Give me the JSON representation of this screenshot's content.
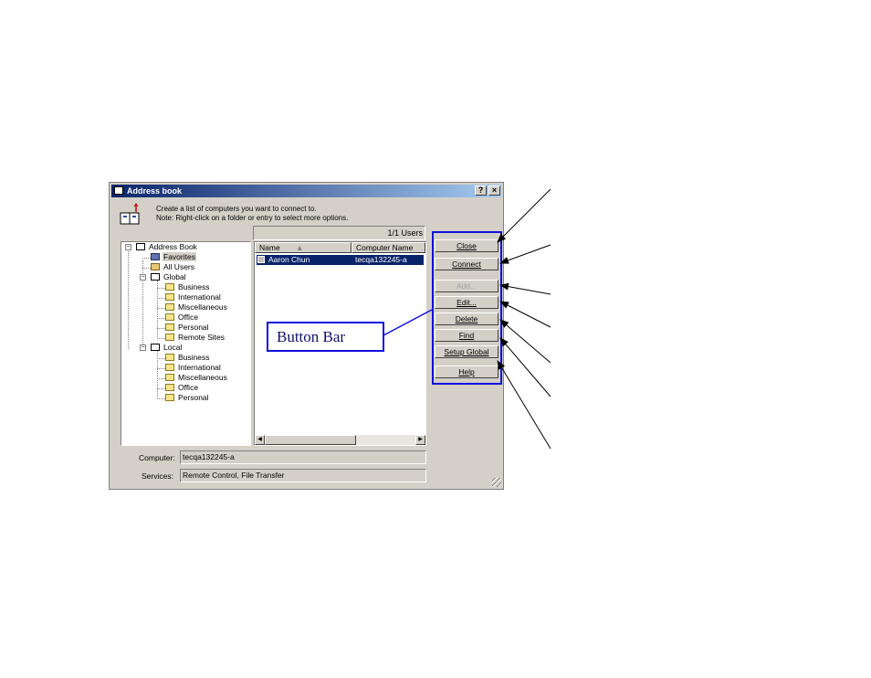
{
  "window": {
    "title": "Address book",
    "help_button": "?",
    "close_button": "×"
  },
  "intro": {
    "line1": "Create a list of computers you want to connect to.",
    "line2": "Note: Right-click on a folder or entry to select more options."
  },
  "user_count": "1/1 Users",
  "tree": {
    "root": "Address Book",
    "favorites": "Favorites",
    "all_users": "All Users",
    "global": "Global",
    "global_children": [
      "Business",
      "International",
      "Miscellaneous",
      "Office",
      "Personal",
      "Remote Sites"
    ],
    "local": "Local",
    "local_children": [
      "Business",
      "International",
      "Miscellaneous",
      "Office",
      "Personal"
    ]
  },
  "list": {
    "columns": [
      "Name",
      "Computer Name"
    ],
    "rows": [
      {
        "name": "Aaron Chun",
        "computer": "tecqa132245-a"
      }
    ]
  },
  "details": {
    "computer_label": "Computer:",
    "computer_value": "tecqa132245-a",
    "services_label": "Services:",
    "services_value": "Remote Control, File Transfer"
  },
  "buttons": {
    "close": "Close",
    "connect": "Connect",
    "add": "Add...",
    "edit": "Edit...",
    "delete": "Delete",
    "find": "Find",
    "setup_global": "Setup Global",
    "help": "Help"
  },
  "callout": "Button Bar",
  "colors": {
    "title_start": "#0a246a",
    "title_end": "#a6caf0",
    "selection": "#0a246a",
    "annotation_blue": "#1010e0",
    "dialog_face": "#d4d0c8"
  }
}
